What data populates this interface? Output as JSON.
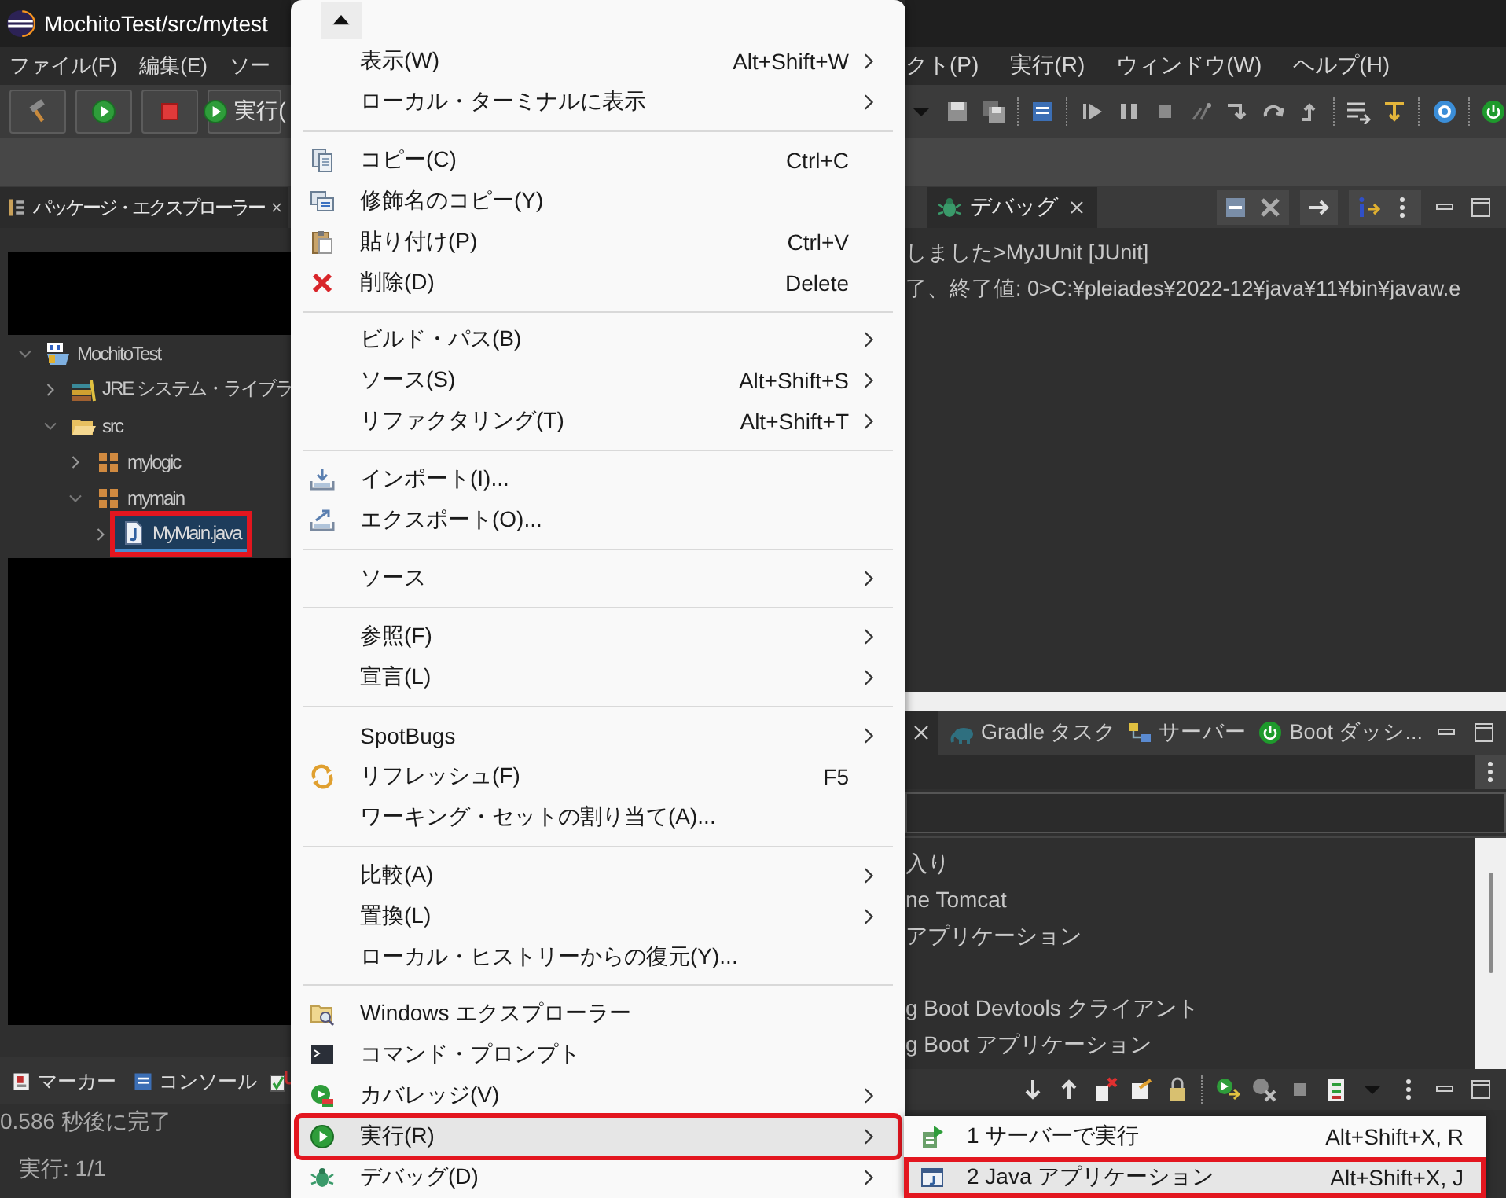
{
  "window": {
    "title": "MochitoTest/src/mytest"
  },
  "menu_bar": {
    "left": [
      {
        "label": "ファイル(F)"
      },
      {
        "label": "編集(E)"
      },
      {
        "label": "ソー"
      }
    ],
    "right": [
      {
        "label": "クト(P)"
      },
      {
        "label": "実行(R)"
      },
      {
        "label": "ウィンドウ(W)"
      },
      {
        "label": "ヘルプ(H)"
      }
    ]
  },
  "toolbar": {
    "run_button": "実行("
  },
  "package_explorer": {
    "tab": {
      "label": "パッケージ・エクスプローラー",
      "selected": true
    },
    "tree": [
      {
        "kind": "project",
        "label": "MochitoTest",
        "expanded": true,
        "selected": false,
        "annotated": false,
        "children": [
          {
            "kind": "library",
            "label": "JRE システム・ライブラ",
            "expanded": false,
            "selected": false,
            "annotated": false
          },
          {
            "kind": "folder",
            "label": "src",
            "expanded": true,
            "selected": false,
            "annotated": false,
            "children": [
              {
                "kind": "package",
                "label": "mylogic",
                "expanded": false,
                "selected": false,
                "annotated": false
              },
              {
                "kind": "package",
                "label": "mymain",
                "expanded": true,
                "selected": false,
                "annotated": false,
                "children": [
                  {
                    "kind": "source_file",
                    "label": "MyMain.java",
                    "expanded": false,
                    "selected": true,
                    "annotated": true
                  }
                ]
              }
            ]
          }
        ]
      }
    ]
  },
  "debug_view": {
    "tab": {
      "label": "デバッグ",
      "selected": true
    },
    "lines": [
      "しました>MyJUnit [JUnit]",
      "了、終了値: 0>C:¥pleiades¥2022-12¥java¥11¥bin¥javaw.e"
    ]
  },
  "servers_view": {
    "tabs": [
      {
        "kind": "gradle",
        "label": "Gradle タスク",
        "selected": false
      },
      {
        "kind": "servers",
        "label": "サーバー",
        "selected": false
      },
      {
        "kind": "boot",
        "label": "Boot ダッシ...",
        "selected": false
      }
    ],
    "items": [
      "入り",
      "ne Tomcat",
      "アプリケーション",
      "g Boot Devtools クライアント",
      "g Boot アプリケーション"
    ]
  },
  "junit_view": {
    "tabs": [
      {
        "kind": "markers",
        "label": "マーカー",
        "selected": false
      },
      {
        "kind": "console",
        "label": "コンソール",
        "selected": false
      }
    ],
    "status": "0.586 秒後に完了",
    "runs": "実行: 1/1"
  },
  "context_menu": {
    "groups": [
      [
        {
          "label": "表示(W)",
          "shortcut": "Alt+Shift+W",
          "submenu": true,
          "selected": false,
          "annotated": false
        },
        {
          "label": "ローカル・ターミナルに表示",
          "submenu": true,
          "selected": false,
          "annotated": false
        }
      ],
      [
        {
          "label": "コピー(C)",
          "shortcut": "Ctrl+C",
          "submenu": false,
          "selected": false,
          "annotated": false
        },
        {
          "label": "修飾名のコピー(Y)",
          "submenu": false,
          "selected": false,
          "annotated": false
        },
        {
          "label": "貼り付け(P)",
          "shortcut": "Ctrl+V",
          "submenu": false,
          "selected": false,
          "annotated": false
        },
        {
          "label": "削除(D)",
          "shortcut": "Delete",
          "submenu": false,
          "selected": false,
          "annotated": false
        }
      ],
      [
        {
          "label": "ビルド・パス(B)",
          "submenu": true,
          "selected": false,
          "annotated": false
        },
        {
          "label": "ソース(S)",
          "shortcut": "Alt+Shift+S",
          "submenu": true,
          "selected": false,
          "annotated": false
        },
        {
          "label": "リファクタリング(T)",
          "shortcut": "Alt+Shift+T",
          "submenu": true,
          "selected": false,
          "annotated": false
        }
      ],
      [
        {
          "label": "インポート(I)...",
          "submenu": false,
          "selected": false,
          "annotated": false
        },
        {
          "label": "エクスポート(O)...",
          "submenu": false,
          "selected": false,
          "annotated": false
        }
      ],
      [
        {
          "label": "ソース",
          "submenu": true,
          "selected": false,
          "annotated": false
        }
      ],
      [
        {
          "label": "参照(F)",
          "submenu": true,
          "selected": false,
          "annotated": false
        },
        {
          "label": "宣言(L)",
          "submenu": true,
          "selected": false,
          "annotated": false
        }
      ],
      [
        {
          "label": "SpotBugs",
          "submenu": true,
          "selected": false,
          "annotated": false
        },
        {
          "label": "リフレッシュ(F)",
          "shortcut": "F5",
          "submenu": false,
          "selected": false,
          "annotated": false
        },
        {
          "label": "ワーキング・セットの割り当て(A)...",
          "submenu": false,
          "selected": false,
          "annotated": false
        }
      ],
      [
        {
          "label": "比較(A)",
          "submenu": true,
          "selected": false,
          "annotated": false
        },
        {
          "label": "置換(L)",
          "submenu": true,
          "selected": false,
          "annotated": false
        },
        {
          "label": "ローカル・ヒストリーからの復元(Y)...",
          "submenu": false,
          "selected": false,
          "annotated": false
        }
      ],
      [
        {
          "label": "Windows エクスプローラー",
          "submenu": false,
          "selected": false,
          "annotated": false
        },
        {
          "label": "コマンド・プロンプト",
          "submenu": false,
          "selected": false,
          "annotated": false
        },
        {
          "label": "カバレッジ(V)",
          "submenu": true,
          "selected": false,
          "annotated": false
        },
        {
          "label": "実行(R)",
          "submenu": true,
          "selected": true,
          "annotated": true
        },
        {
          "label": "デバッグ(D)",
          "submenu": true,
          "selected": false,
          "annotated": false
        }
      ]
    ]
  },
  "run_submenu": {
    "items": [
      {
        "kind": "server",
        "label": "1 サーバーで実行",
        "shortcut": "Alt+Shift+X, R",
        "selected": false,
        "annotated": false
      },
      {
        "kind": "java",
        "label": "2 Java アプリケーション",
        "shortcut": "Alt+Shift+X, J",
        "selected": true,
        "annotated": true
      }
    ]
  }
}
